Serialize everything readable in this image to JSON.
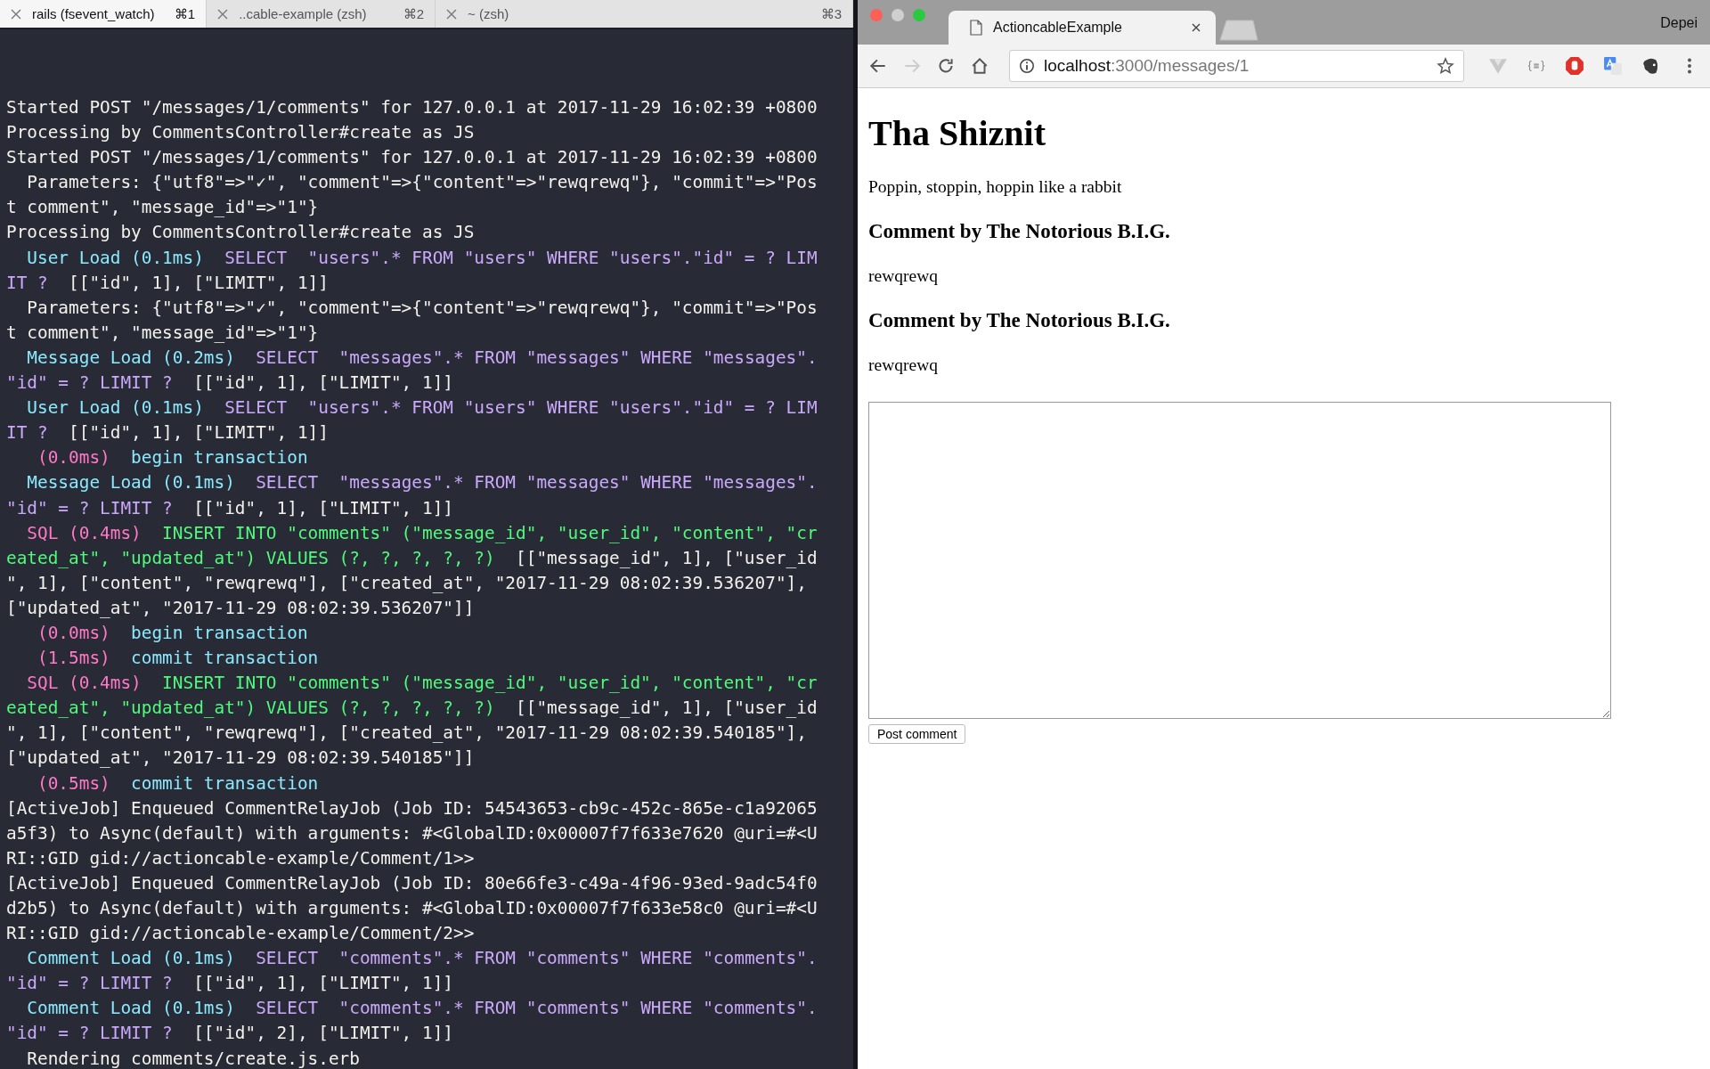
{
  "terminal": {
    "tabs": [
      {
        "title": "rails (fsevent_watch)",
        "shortcut": "⌘1",
        "selected": true
      },
      {
        "title": "..cable-example (zsh)",
        "shortcut": "⌘2",
        "selected": false
      },
      {
        "title": "~ (zsh)",
        "shortcut": "⌘3",
        "selected": false
      }
    ],
    "lines": [
      [
        {
          "kind": "plain",
          "text": "Started POST \"/messages/1/comments\" for 127.0.0.1 at 2017-11-29 16:02:39 +0800"
        }
      ],
      [
        {
          "kind": "plain",
          "text": "Processing by CommentsController#create as JS"
        }
      ],
      [
        {
          "kind": "plain",
          "text": "Started POST \"/messages/1/comments\" for 127.0.0.1 at 2017-11-29 16:02:39 +0800"
        }
      ],
      [
        {
          "kind": "plain",
          "text": "  Parameters: {\"utf8\"=>\"✓\", \"comment\"=>{\"content\"=>\"rewqrewq\"}, \"commit\"=>\"Pos"
        }
      ],
      [
        {
          "kind": "plain",
          "text": "t comment\", \"message_id\"=>\"1\"}"
        }
      ],
      [
        {
          "kind": "plain",
          "text": "Processing by CommentsController#create as JS"
        }
      ],
      [
        {
          "kind": "name",
          "text": "  User Load (0.1ms)"
        },
        {
          "kind": "query",
          "text": "  SELECT  \"users\".* FROM \"users\" WHERE \"users\".\"id\" = ? LIM"
        }
      ],
      [
        {
          "kind": "query",
          "text": "IT ?  "
        },
        {
          "kind": "plain",
          "text": "[[\"id\", 1], [\"LIMIT\", 1]]"
        }
      ],
      [
        {
          "kind": "plain",
          "text": "  Parameters: {\"utf8\"=>\"✓\", \"comment\"=>{\"content\"=>\"rewqrewq\"}, \"commit\"=>\"Pos"
        }
      ],
      [
        {
          "kind": "plain",
          "text": "t comment\", \"message_id\"=>\"1\"}"
        }
      ],
      [
        {
          "kind": "name",
          "text": "  Message Load (0.2ms)"
        },
        {
          "kind": "query",
          "text": "  SELECT  \"messages\".* FROM \"messages\" WHERE \"messages\"."
        }
      ],
      [
        {
          "kind": "query",
          "text": "\"id\" = ? LIMIT ?  "
        },
        {
          "kind": "plain",
          "text": "[[\"id\", 1], [\"LIMIT\", 1]]"
        }
      ],
      [
        {
          "kind": "name",
          "text": "  User Load (0.1ms)"
        },
        {
          "kind": "query",
          "text": "  SELECT  \"users\".* FROM \"users\" WHERE \"users\".\"id\" = ? LIM"
        }
      ],
      [
        {
          "kind": "query",
          "text": "IT ?  "
        },
        {
          "kind": "plain",
          "text": "[[\"id\", 1], [\"LIMIT\", 1]]"
        }
      ],
      [
        {
          "kind": "time",
          "text": "   (0.0ms)"
        },
        {
          "kind": "name",
          "text": "  begin transaction"
        }
      ],
      [
        {
          "kind": "name",
          "text": "  Message Load (0.1ms)"
        },
        {
          "kind": "query",
          "text": "  SELECT  \"messages\".* FROM \"messages\" WHERE \"messages\"."
        }
      ],
      [
        {
          "kind": "query",
          "text": "\"id\" = ? LIMIT ?  "
        },
        {
          "kind": "plain",
          "text": "[[\"id\", 1], [\"LIMIT\", 1]]"
        }
      ],
      [
        {
          "kind": "time",
          "text": "  SQL (0.4ms)"
        },
        {
          "kind": "insert",
          "text": "  INSERT INTO \"comments\" (\"message_id\", \"user_id\", \"content\", \"cr"
        }
      ],
      [
        {
          "kind": "insert",
          "text": "eated_at\", \"updated_at\") VALUES (?, ?, ?, ?, ?)"
        },
        {
          "kind": "plain",
          "text": "  [[\"message_id\", 1], [\"user_id"
        }
      ],
      [
        {
          "kind": "plain",
          "text": "\", 1], [\"content\", \"rewqrewq\"], [\"created_at\", \"2017-11-29 08:02:39.536207\"],"
        }
      ],
      [
        {
          "kind": "plain",
          "text": "[\"updated_at\", \"2017-11-29 08:02:39.536207\"]]"
        }
      ],
      [
        {
          "kind": "time",
          "text": "   (0.0ms)"
        },
        {
          "kind": "name",
          "text": "  begin transaction"
        }
      ],
      [
        {
          "kind": "time",
          "text": "   (1.5ms)"
        },
        {
          "kind": "name",
          "text": "  commit transaction"
        }
      ],
      [
        {
          "kind": "time",
          "text": "  SQL (0.4ms)"
        },
        {
          "kind": "insert",
          "text": "  INSERT INTO \"comments\" (\"message_id\", \"user_id\", \"content\", \"cr"
        }
      ],
      [
        {
          "kind": "insert",
          "text": "eated_at\", \"updated_at\") VALUES (?, ?, ?, ?, ?)"
        },
        {
          "kind": "plain",
          "text": "  [[\"message_id\", 1], [\"user_id"
        }
      ],
      [
        {
          "kind": "plain",
          "text": "\", 1], [\"content\", \"rewqrewq\"], [\"created_at\", \"2017-11-29 08:02:39.540185\"],"
        }
      ],
      [
        {
          "kind": "plain",
          "text": "[\"updated_at\", \"2017-11-29 08:02:39.540185\"]]"
        }
      ],
      [
        {
          "kind": "time",
          "text": "   (0.5ms)"
        },
        {
          "kind": "name",
          "text": "  commit transaction"
        }
      ],
      [
        {
          "kind": "plain",
          "text": "[ActiveJob] Enqueued CommentRelayJob (Job ID: 54543653-cb9c-452c-865e-c1a92065"
        }
      ],
      [
        {
          "kind": "plain",
          "text": "a5f3) to Async(default) with arguments: #<GlobalID:0x00007f7f633e7620 @uri=#<U"
        }
      ],
      [
        {
          "kind": "plain",
          "text": "RI::GID gid://actioncable-example/Comment/1>>"
        }
      ],
      [
        {
          "kind": "plain",
          "text": "[ActiveJob] Enqueued CommentRelayJob (Job ID: 80e66fe3-c49a-4f96-93ed-9adc54f0"
        }
      ],
      [
        {
          "kind": "plain",
          "text": "d2b5) to Async(default) with arguments: #<GlobalID:0x00007f7f633e58c0 @uri=#<U"
        }
      ],
      [
        {
          "kind": "plain",
          "text": "RI::GID gid://actioncable-example/Comment/2>>"
        }
      ],
      [
        {
          "kind": "name",
          "text": "  Comment Load (0.1ms)"
        },
        {
          "kind": "query",
          "text": "  SELECT  \"comments\".* FROM \"comments\" WHERE \"comments\"."
        }
      ],
      [
        {
          "kind": "query",
          "text": "\"id\" = ? LIMIT ?  "
        },
        {
          "kind": "plain",
          "text": "[[\"id\", 1], [\"LIMIT\", 1]]"
        }
      ],
      [
        {
          "kind": "name",
          "text": "  Comment Load (0.1ms)"
        },
        {
          "kind": "query",
          "text": "  SELECT  \"comments\".* FROM \"comments\" WHERE \"comments\"."
        }
      ],
      [
        {
          "kind": "query",
          "text": "\"id\" = ? LIMIT ?  "
        },
        {
          "kind": "plain",
          "text": "[[\"id\", 2], [\"LIMIT\", 1]]"
        }
      ],
      [
        {
          "kind": "plain",
          "text": "  Rendering comments/create.js.erb"
        }
      ]
    ]
  },
  "browser": {
    "tab_title": "ActioncableExample",
    "profile": "Depei",
    "url_host": "localhost",
    "url_path": ":3000/messages/1",
    "page": {
      "title": "Tha Shiznit",
      "body": "Poppin, stoppin, hoppin like a rabbit",
      "comments": [
        {
          "heading": "Comment by The Notorious B.I.G.",
          "content": "rewqrewq"
        },
        {
          "heading": "Comment by The Notorious B.I.G.",
          "content": "rewqrewq"
        }
      ],
      "button": "Post comment"
    }
  }
}
